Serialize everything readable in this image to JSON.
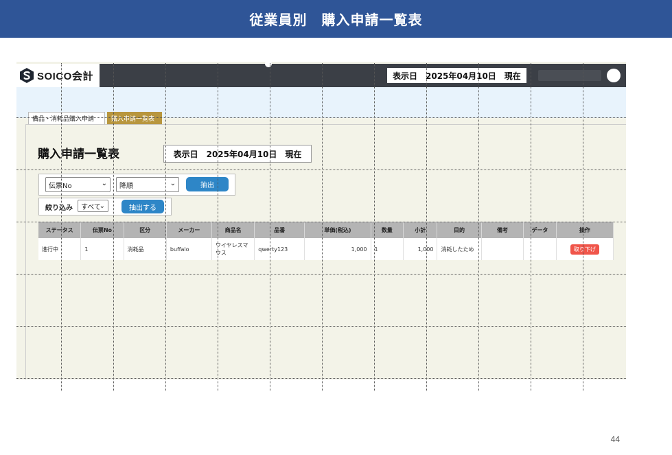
{
  "slide": {
    "title": "従業員別　購入申請一覧表",
    "page_number": "44",
    "header_color": "#2f5597"
  },
  "app": {
    "logo_text": "SOICO会計",
    "logo_icon": "soico-s-hexagon-icon",
    "top_date": "表示日　2025年04月10日　現在"
  },
  "tabs": [
    {
      "label": "備品・消耗品購入申請",
      "active": false
    },
    {
      "label": "購入申請一覧表",
      "active": true
    }
  ],
  "page": {
    "title": "購入申請一覧表",
    "date": "表示日　2025年04月10日　現在"
  },
  "filters": {
    "field_select": "伝票No",
    "order_select": "降順",
    "extract_button": "抽出",
    "narrow_label": "絞り込み",
    "narrow_select": "すべて",
    "extract2_button": "抽出する"
  },
  "table": {
    "headers": [
      "ステータス",
      "伝票No",
      "区分",
      "メーカー",
      "商品名",
      "品番",
      "単価(税込)",
      "数量",
      "小計",
      "目的",
      "備考",
      "データ",
      "操作"
    ],
    "rows": [
      {
        "status": "進行中",
        "slip_no": "1",
        "category": "消耗品",
        "maker": "buffalo",
        "product": "ワイヤレスマウス",
        "part_no": "qwerty123",
        "unit_price": "1,000",
        "quantity": "1",
        "subtotal": "1,000",
        "purpose": "消耗したため",
        "note": "",
        "data": "",
        "action": "取り下げ"
      }
    ]
  },
  "colors": {
    "accent_blue": "#2e86c7",
    "action_red": "#f0554a",
    "active_tab": "#b8963e"
  }
}
